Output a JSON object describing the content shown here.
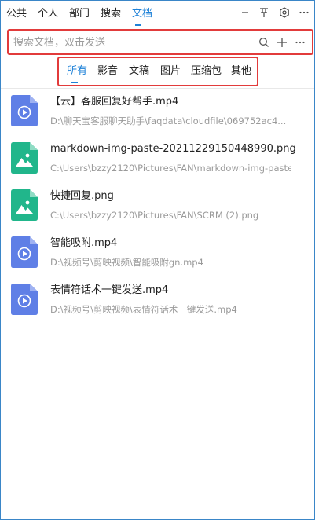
{
  "nav": {
    "tabs": [
      {
        "label": "公共"
      },
      {
        "label": "个人"
      },
      {
        "label": "部门"
      },
      {
        "label": "搜索"
      },
      {
        "label": "文档"
      }
    ],
    "active_tab": "文档",
    "icons": [
      "minimize-icon",
      "pin-icon",
      "settings-icon",
      "more-icon"
    ]
  },
  "search": {
    "placeholder": "搜索文档，双击发送",
    "value": "",
    "icons": [
      "search-icon",
      "add-icon",
      "more-icon"
    ]
  },
  "filter": {
    "tabs": [
      {
        "label": "所有"
      },
      {
        "label": "影音"
      },
      {
        "label": "文稿"
      },
      {
        "label": "图片"
      },
      {
        "label": "压缩包"
      },
      {
        "label": "其他"
      }
    ],
    "active_tab": "所有"
  },
  "files": [
    {
      "name": "【云】客服回复好帮手.mp4",
      "path": "D:\\聊天宝客服聊天助手\\faqdata\\cloudfile\\069752ac4...",
      "type": "video",
      "icon": "video-file-icon",
      "color": "#5f7fe6"
    },
    {
      "name": "markdown-img-paste-20211229150448990.png",
      "path": "C:\\Users\\bzzy2120\\Pictures\\FAN\\markdown-img-paste-...",
      "type": "image",
      "icon": "image-file-icon",
      "color": "#21b68b"
    },
    {
      "name": "快捷回复.png",
      "path": "C:\\Users\\bzzy2120\\Pictures\\FAN\\SCRM (2).png",
      "type": "image",
      "icon": "image-file-icon",
      "color": "#21b68b"
    },
    {
      "name": "智能吸附.mp4",
      "path": "D:\\视频号\\剪映视频\\智能吸附gn.mp4",
      "type": "video",
      "icon": "video-file-icon",
      "color": "#5f7fe6"
    },
    {
      "name": "表情符话术一键发送.mp4",
      "path": "D:\\视频号\\剪映视频\\表情符话术一键发送.mp4",
      "type": "video",
      "icon": "video-file-icon",
      "color": "#5f7fe6"
    }
  ]
}
